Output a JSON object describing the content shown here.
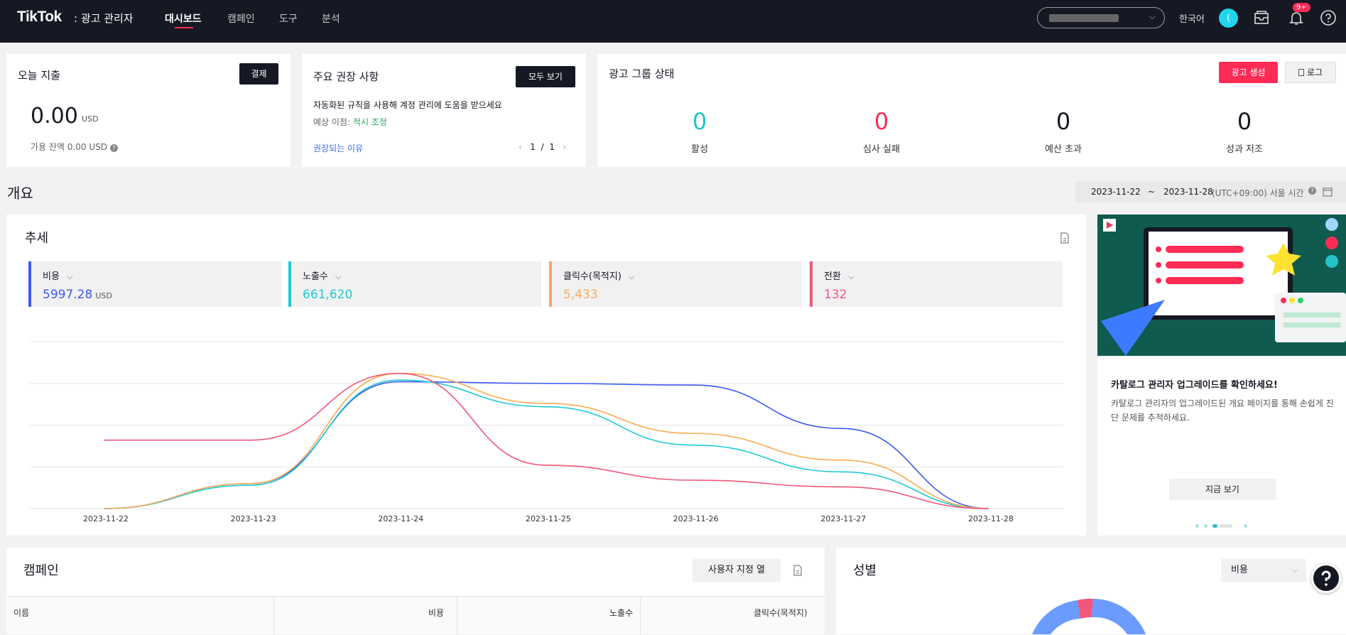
{
  "header": {
    "logo": "TikTok",
    "logo_sub": ": 광고 관리자",
    "nav": [
      "대시보드",
      "캠페인",
      "도구",
      "분석"
    ],
    "lang": "한국어",
    "avatar_initial": "(",
    "notif_badge": "9+"
  },
  "today": {
    "title": "오늘 지출",
    "pay_button": "결제",
    "amount": "0.00",
    "unit": "USD",
    "balance": "가용 잔액 0.00 USD"
  },
  "recommend": {
    "title": "주요 권장 사항",
    "view_all": "모두 보기",
    "text": "자동화된 규칙을 사용해 계정 관리에 도움을 받으세요",
    "benefit_label": "예상 이점: ",
    "benefit_value": "적시 조정",
    "why_link": "권장되는 이유",
    "page_current": "1",
    "page_sep": "/",
    "page_total": "1"
  },
  "adgroup": {
    "title": "광고 그룹 상태",
    "create_button": "광고 생성",
    "log_button": "로그",
    "stats": [
      {
        "value": "0",
        "label": "활성",
        "color": "#25c3c8"
      },
      {
        "value": "0",
        "label": "심사 실패",
        "color": "#fe2c55"
      },
      {
        "value": "0",
        "label": "예산 초과",
        "color": "#161823"
      },
      {
        "value": "0",
        "label": "성과 저조",
        "color": "#161823"
      }
    ]
  },
  "overview": {
    "title": "개요",
    "date_start": "2023-11-22",
    "date_sep": "~",
    "date_end": "2023-11-28",
    "timezone": "(UTC+09:00) 서울 시간"
  },
  "trend": {
    "title": "추세",
    "metrics": [
      {
        "label": "비용",
        "value": "5997.28",
        "unit": "USD",
        "color": "#3c5bf0"
      },
      {
        "label": "노출수",
        "value": "661,620",
        "unit": "",
        "color": "#1fc9d3"
      },
      {
        "label": "클릭수(목적지)",
        "value": "5,433",
        "unit": "",
        "color": "#f9ab52"
      },
      {
        "label": "전환",
        "value": "132",
        "unit": "",
        "color": "#f2567a"
      }
    ]
  },
  "chart_data": {
    "type": "line",
    "x": [
      "2023-11-22",
      "2023-11-23",
      "2023-11-24",
      "2023-11-25",
      "2023-11-26",
      "2023-11-27",
      "2023-11-28"
    ],
    "ylim": [
      0,
      100
    ],
    "grid": true,
    "series": [
      {
        "name": "비용",
        "color": "#3c5bf0",
        "values": [
          0,
          15,
          76,
          75,
          74,
          48,
          0
        ]
      },
      {
        "name": "노출수",
        "color": "#1fc9d3",
        "values": [
          0,
          14,
          77,
          61,
          38,
          22,
          0
        ]
      },
      {
        "name": "클릭수(목적지)",
        "color": "#f9ab52",
        "values": [
          0,
          15,
          81,
          63,
          45,
          29,
          0
        ]
      },
      {
        "name": "전환",
        "color": "#f2567a",
        "values": [
          41,
          41,
          81,
          26,
          17,
          13,
          0
        ]
      }
    ]
  },
  "promo": {
    "title": "카탈로그 관리자 업그레이드를 확인하세요!",
    "body": "카탈로그 관리자의 업그레이드된 개요 페이지를 통해 손쉽게 진단 문제를 추적하세요.",
    "button": "지금 보기"
  },
  "campaign": {
    "title": "캠페인",
    "custom_columns": "사용자 지정 열",
    "columns": [
      "이름",
      "비용",
      "노출수",
      "클릭수(목적지)"
    ]
  },
  "gender": {
    "title": "성별",
    "select": "비용"
  }
}
